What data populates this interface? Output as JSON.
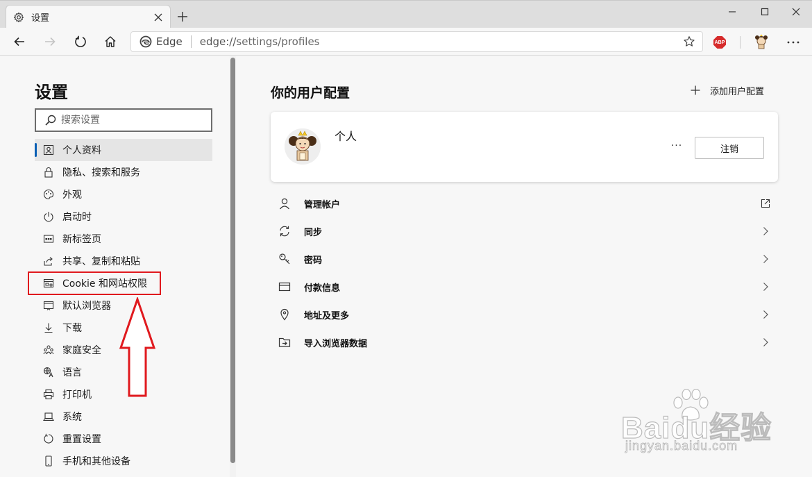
{
  "browser": {
    "tab": {
      "title": "设置",
      "icon": "gear-icon"
    },
    "address": {
      "site_label": "Edge",
      "url_host": "edge://",
      "url_path": "settings/profiles"
    },
    "extensions": {
      "abp_label": "ABP"
    }
  },
  "sidebar": {
    "title": "设置",
    "search_placeholder": "搜索设置",
    "items": [
      {
        "label": "个人资料",
        "icon": "profile-icon",
        "active": true
      },
      {
        "label": "隐私、搜索和服务",
        "icon": "lock-icon"
      },
      {
        "label": "外观",
        "icon": "palette-icon"
      },
      {
        "label": "启动时",
        "icon": "power-icon"
      },
      {
        "label": "新标签页",
        "icon": "new-tab-icon"
      },
      {
        "label": "共享、复制和粘贴",
        "icon": "share-icon"
      },
      {
        "label": "Cookie 和网站权限",
        "icon": "site-permissions-icon"
      },
      {
        "label": "默认浏览器",
        "icon": "default-browser-icon"
      },
      {
        "label": "下载",
        "icon": "download-icon"
      },
      {
        "label": "家庭安全",
        "icon": "family-icon"
      },
      {
        "label": "语言",
        "icon": "language-icon"
      },
      {
        "label": "打印机",
        "icon": "printer-icon"
      },
      {
        "label": "系统",
        "icon": "system-icon"
      },
      {
        "label": "重置设置",
        "icon": "reset-icon"
      },
      {
        "label": "手机和其他设备",
        "icon": "phone-icon"
      }
    ]
  },
  "main": {
    "title": "你的用户配置",
    "add_profile_label": "添加用户配置",
    "profile": {
      "name": "个人",
      "signout_label": "注销",
      "more_label": "···"
    },
    "rows": [
      {
        "label": "管理帐户",
        "icon": "person-icon",
        "end": "external-link-icon"
      },
      {
        "label": "同步",
        "icon": "sync-icon",
        "end": "chevron-right-icon"
      },
      {
        "label": "密码",
        "icon": "key-icon",
        "end": "chevron-right-icon"
      },
      {
        "label": "付款信息",
        "icon": "card-icon",
        "end": "chevron-right-icon"
      },
      {
        "label": "地址及更多",
        "icon": "location-icon",
        "end": "chevron-right-icon"
      },
      {
        "label": "导入浏览器数据",
        "icon": "import-icon",
        "end": "chevron-right-icon"
      }
    ]
  },
  "watermark": {
    "main": "Baidu经验",
    "sub": "jingyan.baidu.com"
  },
  "colors": {
    "accent": "#0a5fb4",
    "annotation": "#e0191e"
  }
}
